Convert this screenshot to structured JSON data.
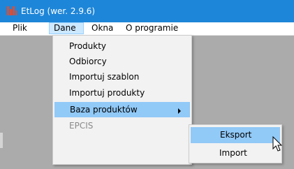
{
  "window": {
    "title": "EtLog (wer. 2.9.6)"
  },
  "menubar": {
    "items": [
      {
        "label": "Plik"
      },
      {
        "label": "Dane"
      },
      {
        "label": "Okna"
      },
      {
        "label": "O programie"
      }
    ],
    "open_menu": "Dane"
  },
  "dane_menu": {
    "items": [
      {
        "label": "Produkty"
      },
      {
        "label": "Odbiorcy"
      },
      {
        "label": "Importuj szablon"
      },
      {
        "label": "Importuj produkty"
      },
      {
        "label": "Baza produktów"
      },
      {
        "label": "EPCIS"
      }
    ],
    "highlighted": "Baza produktów",
    "disabled": "EPCIS"
  },
  "submenu": {
    "items": [
      {
        "label": "Eksport"
      },
      {
        "label": "Import"
      }
    ],
    "highlighted": "Eksport"
  },
  "colors": {
    "titlebar": "#1e86d8",
    "highlight": "#91c9f7",
    "menu_bg": "#f2f2f2",
    "workspace": "#ababab"
  }
}
